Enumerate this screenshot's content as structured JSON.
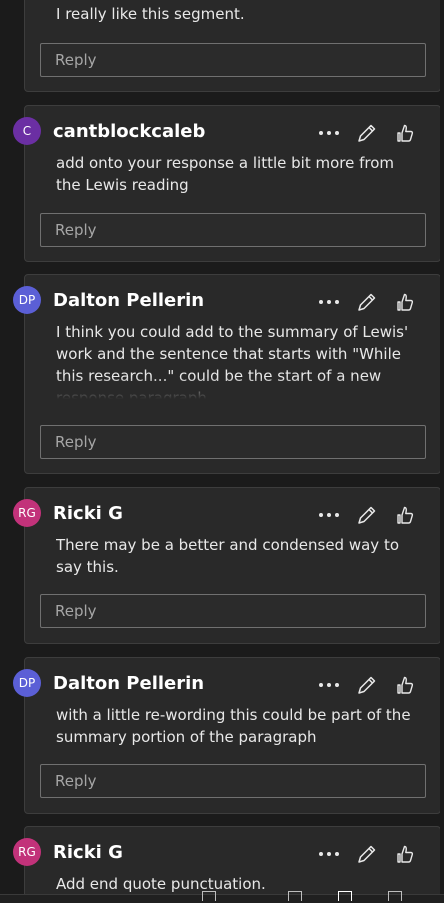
{
  "comments": [
    {
      "initials": "",
      "author": "",
      "body": "I really like this segment.",
      "reply_placeholder": "Reply",
      "avatar_color": ""
    },
    {
      "initials": "C",
      "author": "cantblockcaleb",
      "body": "add onto your response a little bit more from the Lewis reading",
      "reply_placeholder": "Reply",
      "avatar_color": "#6b2fa3"
    },
    {
      "initials": "DP",
      "author": "Dalton Pellerin",
      "body": "I think you could add to the summary of Lewis' work and the sentence that starts with \"While this research...\" could be the start of a new response paragraph.",
      "reply_placeholder": "Reply",
      "avatar_color": "#5b5fd6"
    },
    {
      "initials": "RG",
      "author": "Ricki G",
      "body": "There may be a better and condensed way to say this.",
      "reply_placeholder": "Reply",
      "avatar_color": "#c2327a"
    },
    {
      "initials": "DP",
      "author": "Dalton Pellerin",
      "body": "with a little re-wording this could be part of the summary portion of the paragraph",
      "reply_placeholder": "Reply",
      "avatar_color": "#5b5fd6"
    },
    {
      "initials": "RG",
      "author": "Ricki G",
      "body": "Add end quote punctuation.",
      "reply_placeholder": "Reply",
      "avatar_color": "#c2327a"
    }
  ],
  "icons": {
    "more": "more-options-icon",
    "edit": "pencil-icon",
    "like": "thumbs-up-icon"
  },
  "colors": {
    "background": "#1b1b1b",
    "card": "#292929",
    "card_border": "#3d3d3d",
    "text": "#e8e8e8",
    "placeholder": "#a6a6a6"
  }
}
